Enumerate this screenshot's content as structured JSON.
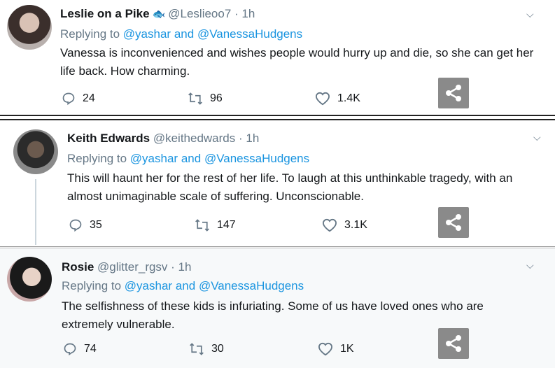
{
  "tweets": [
    {
      "name": "Leslie on a Pike",
      "name_icon": "fish-emoji",
      "handle": "@Leslieoo7",
      "time": "· 1h",
      "replying_prefix": "Replying to",
      "mention1": "@yashar",
      "and": "and",
      "mention2": "@VanessaHudgens",
      "text": "Vanessa is inconvenienced and wishes people would hurry up and die, so she can get her life back. How charming.",
      "replies": "24",
      "retweets": "96",
      "likes": "1.4K"
    },
    {
      "name": "Keith Edwards",
      "handle": "@keithedwards",
      "time": "· 1h",
      "replying_prefix": "Replying to",
      "mention1": "@yashar",
      "and": "and",
      "mention2": "@VanessaHudgens",
      "text": "This will haunt her for the rest of her life. To laugh at this unthinkable tragedy, with an almost unimaginable scale of suffering. Unconscionable.",
      "replies": "35",
      "retweets": "147",
      "likes": "3.1K"
    },
    {
      "name": "Rosie",
      "handle": "@glitter_rgsv",
      "time": "· 1h",
      "replying_prefix": "Replying to",
      "mention1": "@yashar",
      "and": "and",
      "mention2": "@VanessaHudgens",
      "text": "The selfishness of these kids is infuriating. Some of us have loved ones who are extremely vulnerable.",
      "replies": "74",
      "retweets": "30",
      "likes": "1K"
    }
  ],
  "icons": {
    "reply": "reply-icon",
    "retweet": "retweet-icon",
    "like": "heart-icon",
    "share": "share-icon",
    "more": "chevron-down-icon"
  },
  "colors": {
    "link": "#1b95e0",
    "muted": "#657786",
    "text": "#14171a"
  }
}
